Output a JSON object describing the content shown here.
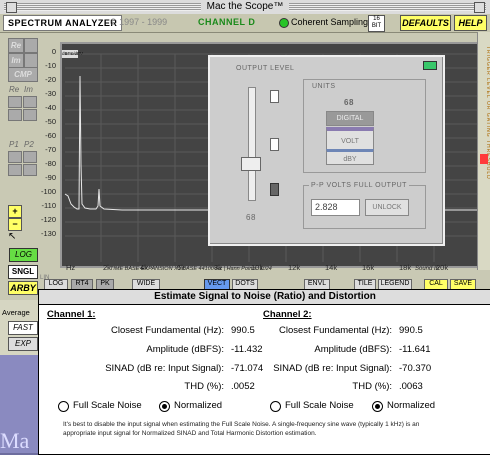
{
  "window": {
    "title": "Mac the Scope™"
  },
  "toolbar": {
    "spectrum_label": "SPECTRUM ANALYZER",
    "copyright": "© 1997 - 1999",
    "channel": "CHANNEL D",
    "coherent_label": "Coherent Sampling",
    "bit_top": "16",
    "bit_bottom": "BIT",
    "defaults_label": "DEFAULTS",
    "help_label": "HELP"
  },
  "left_tools": {
    "re": "Re",
    "im": "Im",
    "cmp": "CMP",
    "re2": "Re",
    "im2": "Im",
    "p1": "P1",
    "p2": "P2",
    "log": "LOG",
    "sngl": "SNGL",
    "arby": "ARBY",
    "lin": "LIN",
    "plus": "+",
    "minus": "−"
  },
  "plot": {
    "y_ticks": [
      "0",
      "-10",
      "-20",
      "-30",
      "-40",
      "-50",
      "-60",
      "-70",
      "-80",
      "-90",
      "-100",
      "-110",
      "-120",
      "-130"
    ],
    "y_unit_tag": "dBFS/dBV",
    "x_ticks": [
      "Hz",
      "2k",
      "4k",
      "6k",
      "8k",
      "10k",
      "12k",
      "14k",
      "16k",
      "18k",
      "20k"
    ],
    "status_line": "TIME BASE EXPANSION X1   BASE 44100 Hz | Hann   Points: 1024",
    "sound_in": "Sound In"
  },
  "right_strip": {
    "text": "TRIGGER LEVEL OR GATING THRESHOLD"
  },
  "output_panel": {
    "title": "OUTPUT LEVEL",
    "units_label": "UNITS",
    "units_value": "68",
    "digital": "DIGITAL",
    "volt": "VOLT",
    "dby": "dBY",
    "level_value": "68",
    "pp_label": "P-P VOLTS FULL OUTPUT",
    "pp_value": "2.828",
    "unlock": "UNLOCK"
  },
  "bottom_bar": {
    "log": "LOG",
    "rt4": "RT4",
    "pk": "PK",
    "wide": "WIDE",
    "vect": "VECT",
    "dots": "DOTS",
    "envl": "ENVL",
    "tile": "TILE",
    "legend": "LEGEND",
    "cal": "CAL",
    "save": "SAVE"
  },
  "bottom_left": {
    "average": "Average",
    "fast": "FAST",
    "exp": "EXP",
    "mac": "Ma"
  },
  "dialog": {
    "title": "Estimate Signal to Noise (Ratio) and Distortion",
    "ch1": {
      "heading": "Channel 1:",
      "fund_label": "Closest Fundamental (Hz):",
      "fund": "990.5",
      "amp_label": "Amplitude (dBFS):",
      "amp": "-11.432",
      "sinad_label": "SINAD (dB re: Input Signal):",
      "sinad": "-71.074",
      "thd_label": "THD (%):",
      "thd": ".0052",
      "radio_full": "Full Scale Noise",
      "radio_norm": "Normalized"
    },
    "ch2": {
      "heading": "Channel 2:",
      "fund_label": "Closest Fundamental (Hz):",
      "fund": "990.5",
      "amp_label": "Amplitude (dBFS):",
      "amp": "-11.641",
      "sinad_label": "SINAD (dB re: Input Signal):",
      "sinad": "-70.370",
      "thd_label": "THD (%):",
      "thd": ".0063",
      "radio_full": "Full Scale Noise",
      "radio_norm": "Normalized"
    },
    "note": "It's best to disable the input signal when estimating the Full Scale Noise.  A single-frequency sine wave (typically 1 kHz) is an appropriate input signal for Normalized SINAD and Total Harmonic Distortion estimation."
  }
}
